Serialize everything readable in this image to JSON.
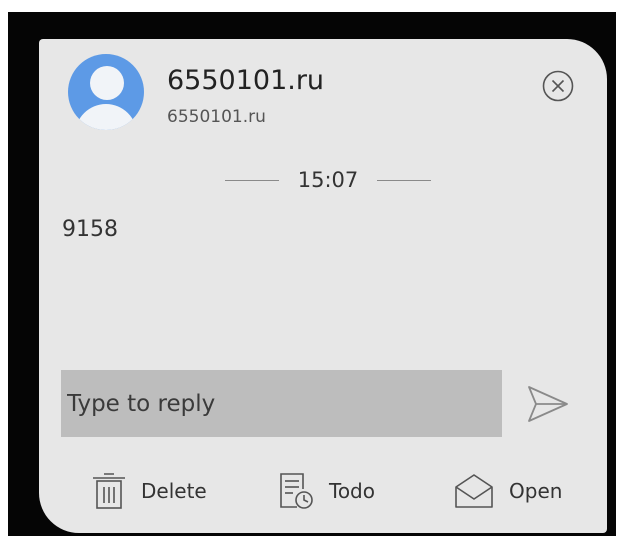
{
  "notification": {
    "sender_name": "6550101.ru",
    "sender_sub": "6550101.ru",
    "time": "15:07",
    "message": "9158"
  },
  "reply": {
    "placeholder": "Type to reply"
  },
  "actions": [
    {
      "label": "Delete",
      "icon": "trash-icon"
    },
    {
      "label": "Todo",
      "icon": "todo-clock-icon"
    },
    {
      "label": "Open",
      "icon": "envelope-open-icon"
    }
  ],
  "icons": {
    "close": "close-circle-icon",
    "send": "send-icon",
    "avatar": "person-icon"
  },
  "colors": {
    "avatar_blue": "#5d9ae6",
    "card_background": "#e7e7e7",
    "input_background": "#bdbdbd"
  }
}
